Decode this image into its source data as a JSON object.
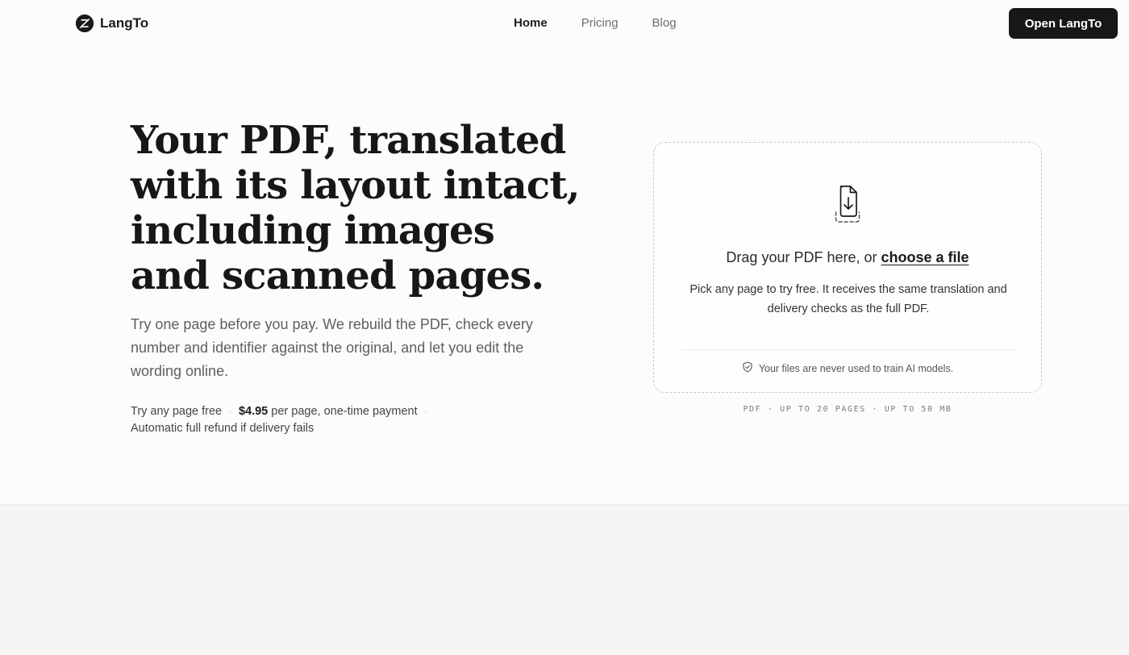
{
  "brand": {
    "name": "LangTo"
  },
  "nav": {
    "items": [
      {
        "label": "Home",
        "active": true
      },
      {
        "label": "Pricing",
        "active": false
      },
      {
        "label": "Blog",
        "active": false
      }
    ],
    "cta": "Open LangTo"
  },
  "hero": {
    "title": "Your PDF, translated with its layout intact, including images and scanned pages.",
    "subtitle": "Try one page before you pay. We rebuild the PDF, check every number and identifier against the original, and let you edit the wording online.",
    "meta": {
      "free": "Try any page free",
      "price": "$4.95",
      "price_suffix": "per page, one-time payment",
      "refund": "Automatic full refund if delivery fails"
    }
  },
  "upload": {
    "title_prefix": "Drag your PDF here, or",
    "choose": "choose a file",
    "description": "Pick any page to try free. It receives the same translation and delivery checks as the full PDF.",
    "privacy": "Your files are never used to train AI models.",
    "limits": "PDF · UP TO 20 PAGES · UP TO 50 MB"
  },
  "colors": {
    "accent": "#171717",
    "background": "#fdfcfb",
    "section": "#f6f5f3",
    "muted": "#6f6f6f"
  },
  "icons": [
    "langto-logo-icon",
    "file-download-icon",
    "shield-check-icon"
  ]
}
